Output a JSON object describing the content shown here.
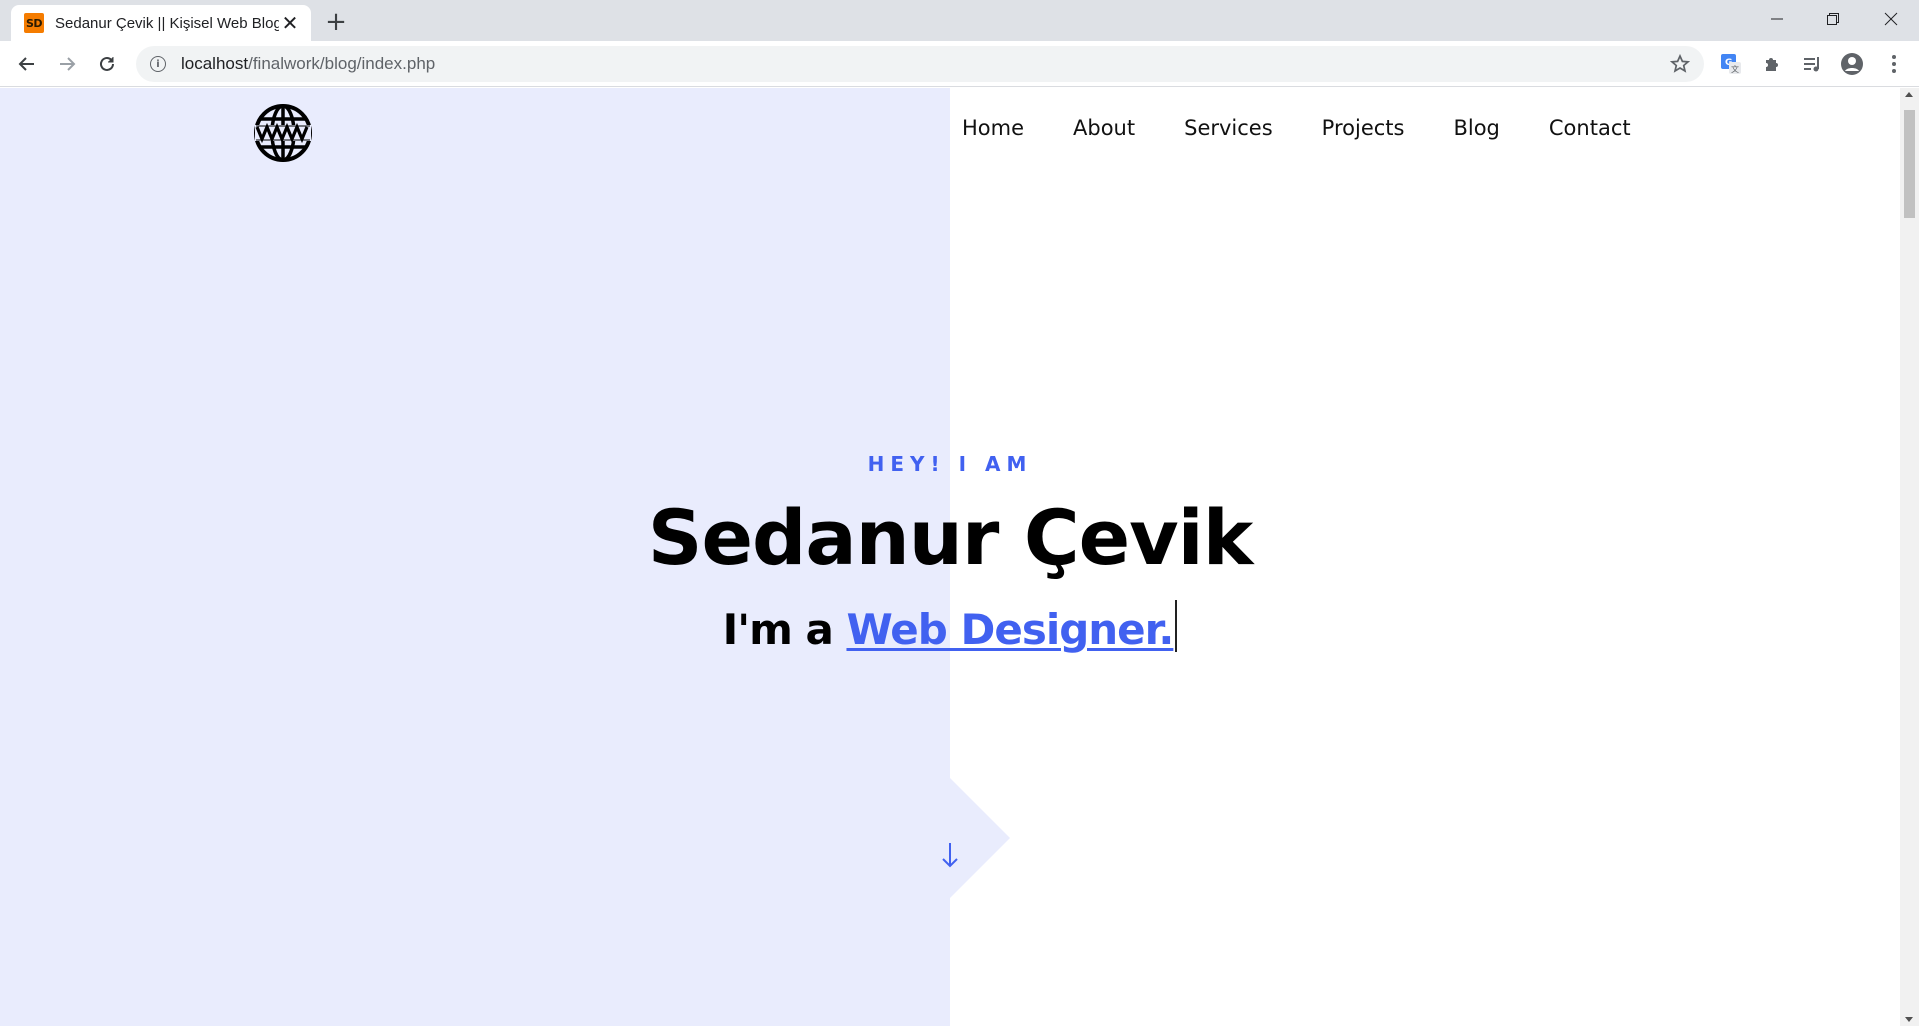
{
  "browser": {
    "tab": {
      "favicon_text": "SD",
      "title": "Sedanur Çevik || Kişisel Web Blog",
      "close_symbol": "✕"
    },
    "new_tab_symbol": "+",
    "url_host": "localhost",
    "url_path": "/finalwork/blog/index.php",
    "colors": {
      "tabbar": "#dee1e6",
      "favicon": "#f57c00"
    }
  },
  "site": {
    "logo_icon": "globe-www-icon",
    "nav": {
      "home": "Home",
      "about": "About",
      "services": "Services",
      "projects": "Projects",
      "blog": "Blog",
      "contact": "Contact"
    },
    "hero": {
      "kicker": "HEY! I AM",
      "name": "Sedanur Çevik",
      "role_prefix": "I'm a ",
      "role": "Web Designer."
    },
    "colors": {
      "accent": "#4161f0",
      "left_panel": "#e9ecfd"
    }
  }
}
